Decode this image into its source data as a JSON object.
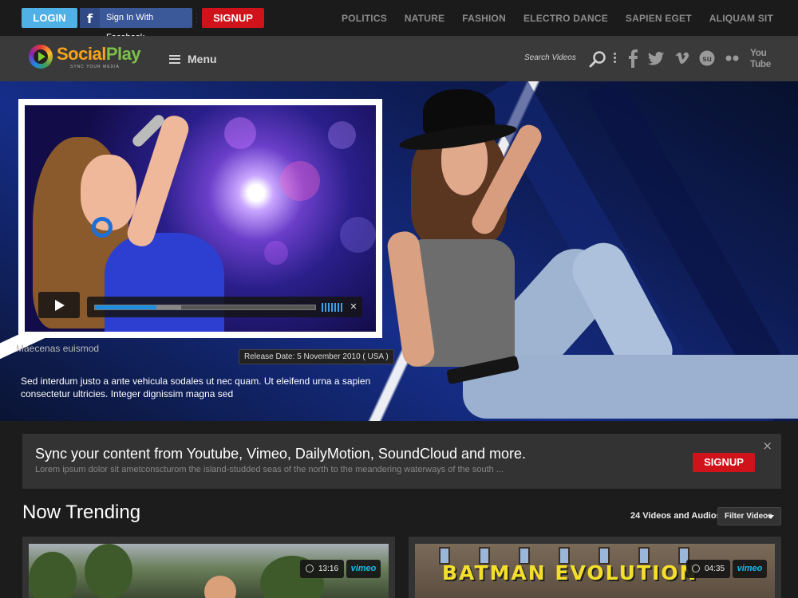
{
  "topbar": {
    "login_label": "LOGIN",
    "facebook_icon": "f",
    "facebook_label": "Sign In With Facebook",
    "signup_label": "SIGNUP",
    "nav": [
      "POLITICS",
      "NATURE",
      "FASHION",
      "ELECTRO DANCE",
      "SAPIEN EGET",
      "ALIQUAM SIT"
    ]
  },
  "header": {
    "logo_part1": "Social",
    "logo_part2": "Play",
    "logo_tagline": "SYNC YOUR MEDIA",
    "menu_label": "Menu",
    "search_label": "Search Videos",
    "social_icons": [
      "facebook-icon",
      "twitter-icon",
      "vimeo-icon",
      "stumbleupon-icon",
      "flickr-icon",
      "youtube-icon"
    ],
    "youtube_label": "You Tube"
  },
  "hero": {
    "caption": "Maecenas euismod",
    "release": "Release Date: 5 November 2010 ( USA )",
    "description": "Sed interdum justo a ante vehicula sodales ut nec quam. Ut eleifend urna a sapien consectetur ultricies. Integer dignissim magna sed",
    "player": {
      "played_fraction": 0.28,
      "loaded_fraction": 0.39
    }
  },
  "sync_banner": {
    "title": "Sync your content from Youtube, Vimeo, DailyMotion, SoundCloud and more.",
    "subtitle": "Lorem ipsum dolor sit ametconscturom the island-studded seas of the north to the meandering waterways of the south ...",
    "signup_label": "SIGNUP",
    "close_icon": "×"
  },
  "trending": {
    "title": "Now Trending",
    "count_label": "24 Videos and Audios",
    "filter_label": "Filter Videos",
    "cards": [
      {
        "duration": "13:16",
        "source": "vimeo"
      },
      {
        "duration": "04:35",
        "source": "vimeo",
        "thumb_text": "BATMAN EVOLUTION"
      }
    ]
  },
  "colors": {
    "login_blue": "#4fb1e6",
    "signup_red": "#d0131a",
    "facebook_blue": "#3b5998",
    "progress_blue": "#1e8fe0",
    "vimeo_blue": "#1ab7ea"
  }
}
